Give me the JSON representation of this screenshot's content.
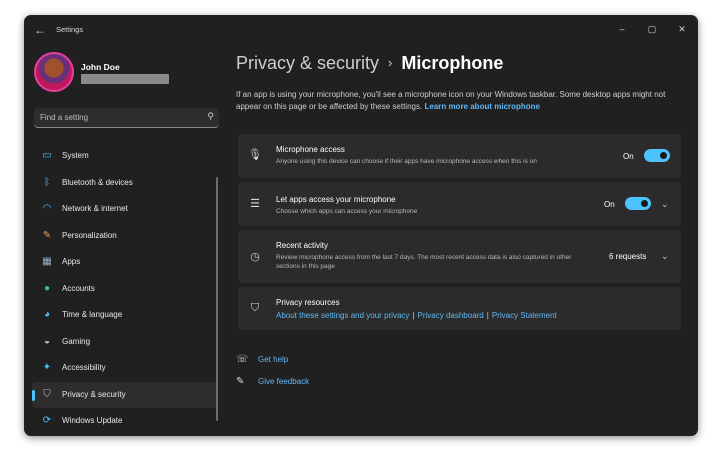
{
  "window": {
    "title": "Settings",
    "back_glyph": "←",
    "minimize_glyph": "–",
    "maximize_glyph": "▢",
    "close_glyph": "✕"
  },
  "profile": {
    "name": "John Doe"
  },
  "search": {
    "placeholder": "Find a setting",
    "icon": "search-icon",
    "glyph": "⚲"
  },
  "sidebar": {
    "items": [
      {
        "label": "System",
        "icon": "system-icon",
        "glyph": "▭",
        "color": "#4cc2ff",
        "active": false
      },
      {
        "label": "Bluetooth & devices",
        "icon": "bluetooth-icon",
        "glyph": "ᛒ",
        "color": "#4cc2ff",
        "active": false
      },
      {
        "label": "Network & internet",
        "icon": "wifi-icon",
        "glyph": "◠",
        "color": "#4cc2ff",
        "active": false
      },
      {
        "label": "Personalization",
        "icon": "brush-icon",
        "glyph": "✎",
        "color": "#f0a060",
        "active": false
      },
      {
        "label": "Apps",
        "icon": "apps-icon",
        "glyph": "▦",
        "color": "#9ab0cc",
        "active": false
      },
      {
        "label": "Accounts",
        "icon": "accounts-icon",
        "glyph": "●",
        "color": "#3cc48c",
        "active": false
      },
      {
        "label": "Time & language",
        "icon": "globe-icon",
        "glyph": "◕",
        "color": "#4cc2ff",
        "active": false
      },
      {
        "label": "Gaming",
        "icon": "gamepad-icon",
        "glyph": "◒",
        "color": "#c8c8c8",
        "active": false
      },
      {
        "label": "Accessibility",
        "icon": "accessibility-icon",
        "glyph": "✦",
        "color": "#4cc2ff",
        "active": false
      },
      {
        "label": "Privacy & security",
        "icon": "shield-icon",
        "glyph": "⛉",
        "color": "#bfbfbf",
        "active": true
      },
      {
        "label": "Windows Update",
        "icon": "update-icon",
        "glyph": "⟳",
        "color": "#4cc2ff",
        "active": false
      }
    ]
  },
  "breadcrumb": {
    "parent": "Privacy & security",
    "separator": "›",
    "current": "Microphone"
  },
  "description": {
    "text": "If an app is using your microphone, you'll see a microphone icon on your Windows taskbar. Some desktop apps might not appear on this page or be affected by these settings. ",
    "link": "Learn more about microphone"
  },
  "cards": {
    "mic_access": {
      "title": "Microphone access",
      "subtitle": "Anyone using this device can choose if their apps have microphone access when this is on",
      "state": "On",
      "icon": "microphone-icon",
      "glyph": "🎙"
    },
    "apps_access": {
      "title": "Let apps access your microphone",
      "subtitle": "Choose which apps can access your microphone",
      "state": "On",
      "icon": "list-icon",
      "glyph": "☰"
    },
    "recent": {
      "title": "Recent activity",
      "subtitle": "Review microphone access from the last 7 days. The most recent access data is also captured in other sections in this page",
      "value": "6 requests",
      "icon": "history-icon",
      "glyph": "◷"
    },
    "resources": {
      "title": "Privacy resources",
      "icon": "shield-icon",
      "glyph": "⛉",
      "links": [
        "About these settings and your privacy",
        "Privacy dashboard",
        "Privacy Statement"
      ],
      "separator": "|"
    }
  },
  "help": {
    "get_help": "Get help",
    "get_help_glyph": "☏",
    "feedback": "Give feedback",
    "feedback_glyph": "✎"
  },
  "colors": {
    "accent": "#4cc2ff",
    "link": "#5fb8f5",
    "window_bg": "#202020",
    "card_bg": "#2b2b2b"
  }
}
